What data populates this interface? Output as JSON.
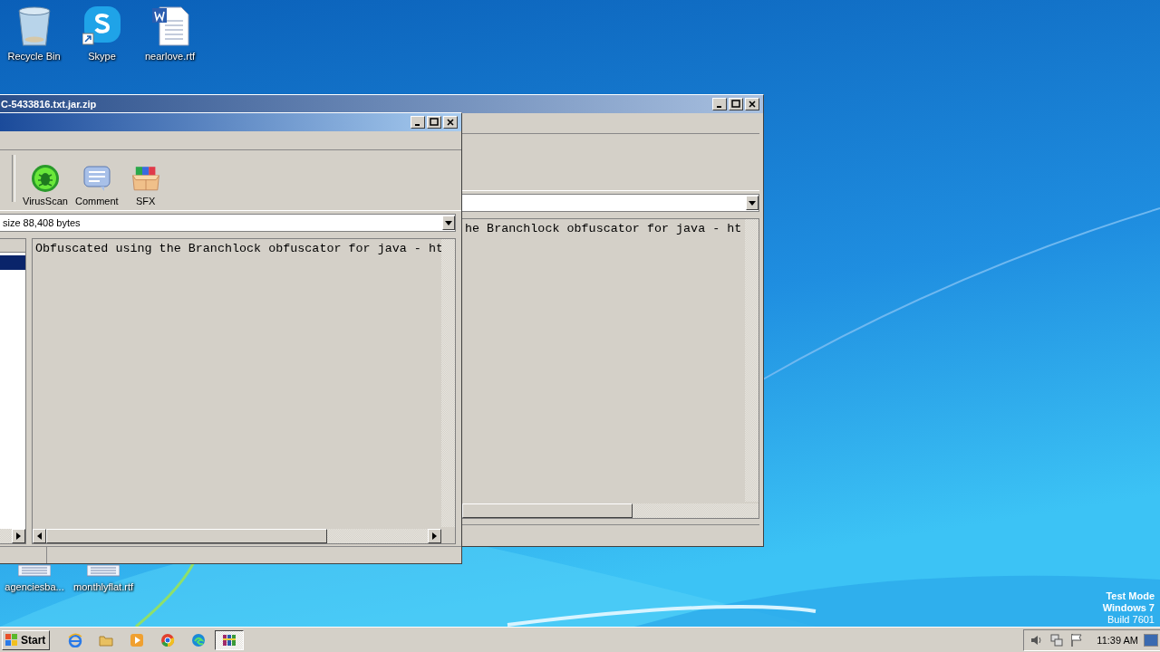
{
  "desktop_icons": [
    {
      "label": "Recycle Bin",
      "kind": "bin"
    },
    {
      "label": "Skype",
      "kind": "skype"
    },
    {
      "label": "nearlove.rtf",
      "kind": "word"
    }
  ],
  "bottom_icons": [
    {
      "label": "agenciesba..."
    },
    {
      "label": "monthlyflat.rtf"
    }
  ],
  "back_window": {
    "title": "C-5433816.txt.jar.zip",
    "comment_text": "he Branchlock obfuscator for java - ht"
  },
  "front_window": {
    "toolbar": [
      {
        "label": "VirusScan",
        "kind": "virus"
      },
      {
        "label": "Comment",
        "kind": "comment"
      },
      {
        "label": "SFX",
        "kind": "sfx"
      }
    ],
    "address": "size 88,408 bytes",
    "comment_text": "Obfuscated using the Branchlock obfuscator for java - ht"
  },
  "taskbar": {
    "start": "Start",
    "apps": [
      {
        "kind": "ie",
        "active": false
      },
      {
        "kind": "folder",
        "active": false
      },
      {
        "kind": "media",
        "active": false
      },
      {
        "kind": "chrome",
        "active": false
      },
      {
        "kind": "edge",
        "active": false
      },
      {
        "kind": "winrar",
        "active": true
      }
    ],
    "clock": "11:39 AM"
  },
  "os_notice": [
    "Test Mode",
    "Windows 7",
    "Build 7601"
  ]
}
